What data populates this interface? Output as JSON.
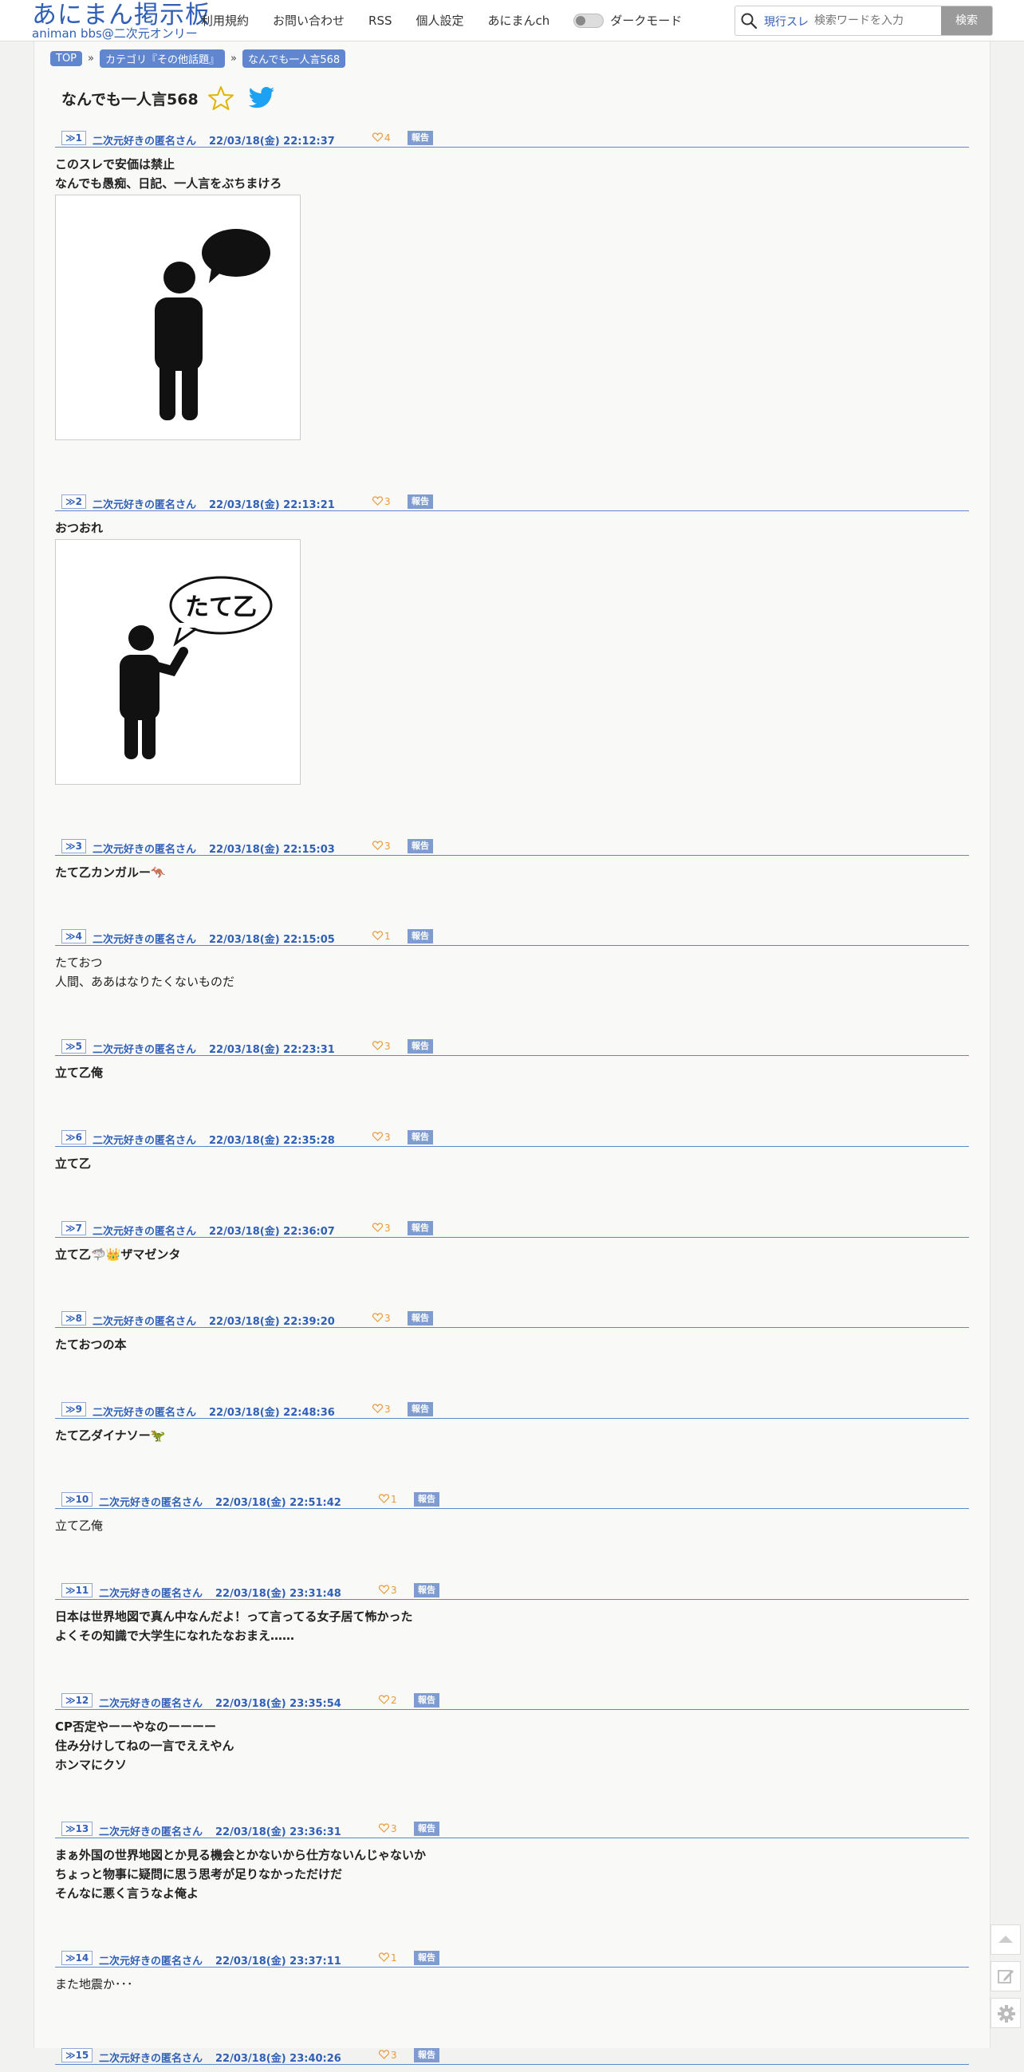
{
  "header": {
    "logo_main": "あにまん掲示板",
    "logo_sub": "animan bbs@二次元オンリー",
    "nav": [
      "利用規約",
      "お問い合わせ",
      "RSS",
      "個人設定",
      "あにまんch"
    ],
    "dark_mode_label": "ダークモード",
    "search_scope": "現行スレ",
    "search_placeholder": "検索ワードを入力",
    "search_button": "検索"
  },
  "breadcrumb": [
    "TOP",
    "カテゴリ『その他話題』",
    "なんでも一人言568"
  ],
  "thread_title": "なんでも一人言568",
  "report_label": "報告",
  "posts": [
    {
      "num": "1",
      "name": "二次元好きの匿名さん",
      "date": "22/03/18(金) 22:12:37",
      "likes": "4",
      "lines": [
        "このスレで安価は禁止",
        "なんでも愚痴、日記、一人言をぶちまけろ"
      ],
      "image": "person-speech-bubble"
    },
    {
      "num": "2",
      "name": "二次元好きの匿名さん",
      "date": "22/03/18(金) 22:13:21",
      "likes": "3",
      "lines": [
        "おつおれ"
      ],
      "image": "person-tateotsu",
      "image_text": "たて乙"
    },
    {
      "num": "3",
      "name": "二次元好きの匿名さん",
      "date": "22/03/18(金) 22:15:03",
      "likes": "3",
      "lines": [
        "たて乙カンガルー🦘"
      ]
    },
    {
      "num": "4",
      "name": "二次元好きの匿名さん",
      "date": "22/03/18(金) 22:15:05",
      "likes": "1",
      "lines": [
        "たておつ",
        "人間、ああはなりたくないものだ"
      ]
    },
    {
      "num": "5",
      "name": "二次元好きの匿名さん",
      "date": "22/03/18(金) 22:23:31",
      "likes": "3",
      "lines": [
        "立て乙俺"
      ]
    },
    {
      "num": "6",
      "name": "二次元好きの匿名さん",
      "date": "22/03/18(金) 22:35:28",
      "likes": "3",
      "lines": [
        "立て乙"
      ]
    },
    {
      "num": "7",
      "name": "二次元好きの匿名さん",
      "date": "22/03/18(金) 22:36:07",
      "likes": "3",
      "lines": [
        "立て乙🦈👑ザマゼンタ"
      ]
    },
    {
      "num": "8",
      "name": "二次元好きの匿名さん",
      "date": "22/03/18(金) 22:39:20",
      "likes": "3",
      "lines": [
        "たておつの本"
      ]
    },
    {
      "num": "9",
      "name": "二次元好きの匿名さん",
      "date": "22/03/18(金) 22:48:36",
      "likes": "3",
      "lines": [
        "たて乙ダイナソー🦖"
      ]
    },
    {
      "num": "10",
      "name": "二次元好きの匿名さん",
      "date": "22/03/18(金) 22:51:42",
      "likes": "1",
      "lines": [
        "立て乙俺"
      ]
    },
    {
      "num": "11",
      "name": "二次元好きの匿名さん",
      "date": "22/03/18(金) 23:31:48",
      "likes": "3",
      "lines": [
        "日本は世界地図で真ん中なんだよ！って言ってる女子居て怖かった",
        "よくその知識で大学生になれたなおまえ……"
      ]
    },
    {
      "num": "12",
      "name": "二次元好きの匿名さん",
      "date": "22/03/18(金) 23:35:54",
      "likes": "2",
      "lines": [
        "CP否定やーーやなのーーーー",
        "住み分けしてねの一言でええやん",
        "ホンマにクソ"
      ]
    },
    {
      "num": "13",
      "name": "二次元好きの匿名さん",
      "date": "22/03/18(金) 23:36:31",
      "likes": "3",
      "lines": [
        "まぁ外国の世界地図とか見る機会とかないから仕方ないんじゃないか",
        "ちょっと物事に疑問に思う思考が足りなかっただけだ",
        "そんなに悪く言うなよ俺よ"
      ]
    },
    {
      "num": "14",
      "name": "二次元好きの匿名さん",
      "date": "22/03/18(金) 23:37:11",
      "likes": "1",
      "lines": [
        "また地震か･･･"
      ]
    },
    {
      "num": "15",
      "name": "二次元好きの匿名さん",
      "date": "22/03/18(金) 23:40:26",
      "likes": "3",
      "lines": []
    }
  ]
}
